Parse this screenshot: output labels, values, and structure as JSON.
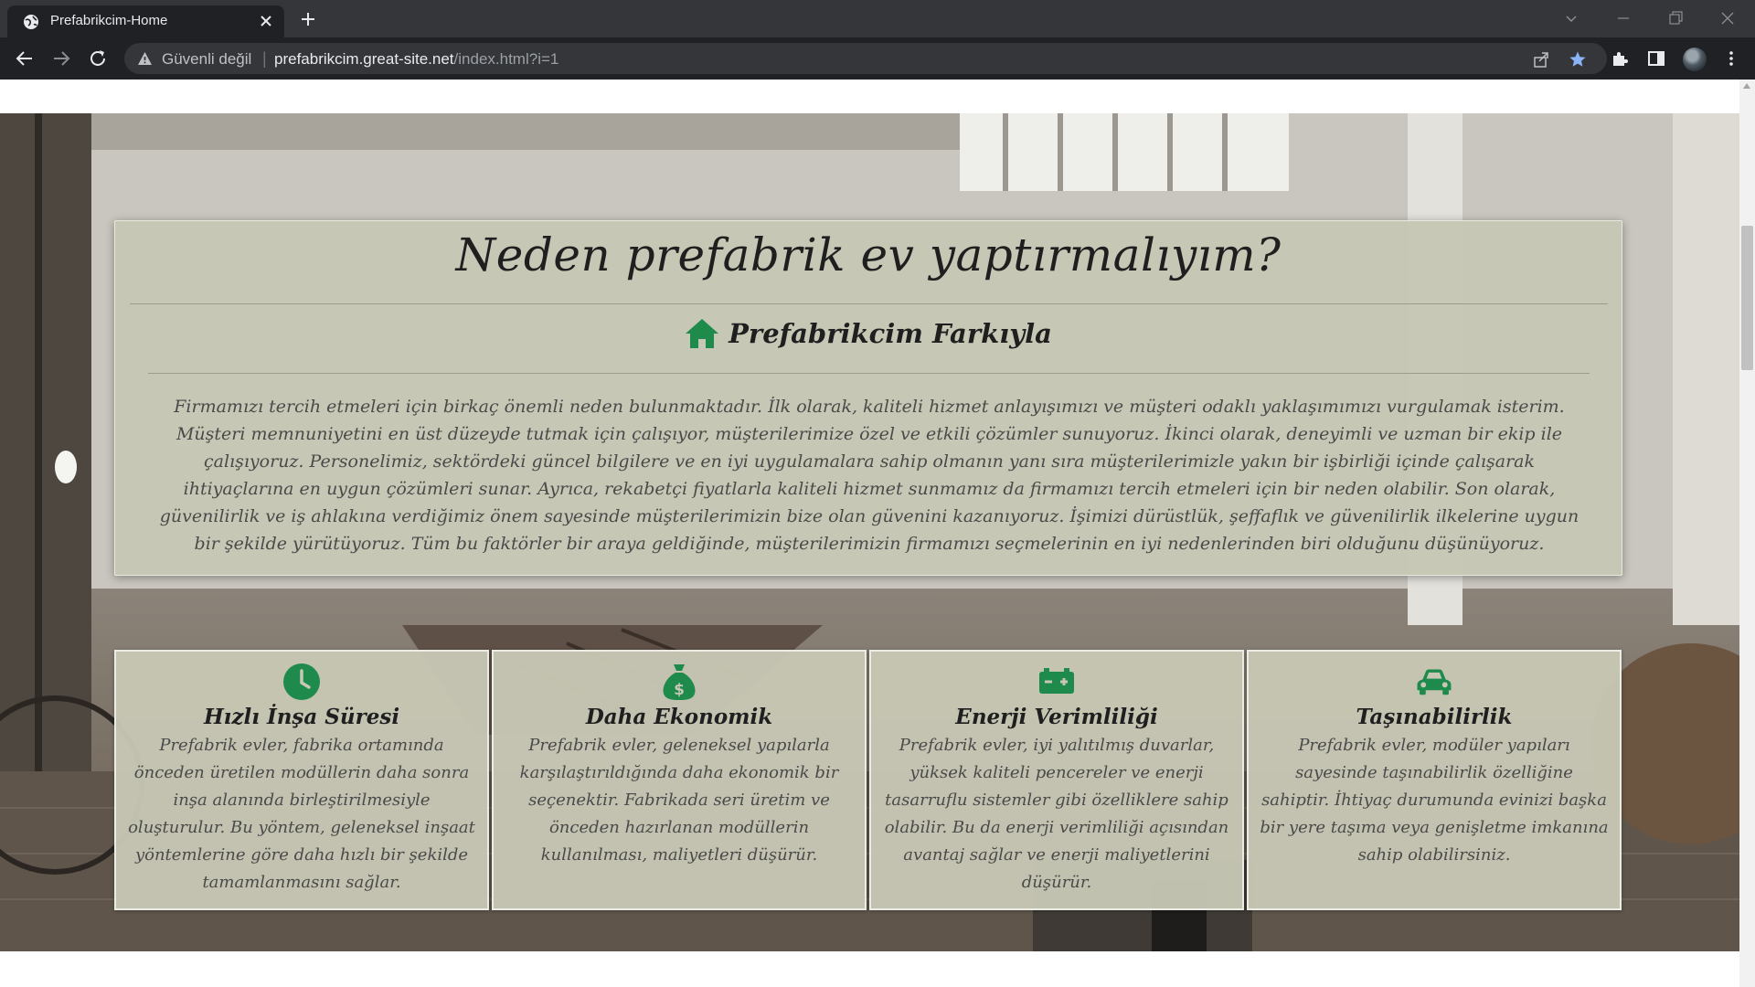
{
  "browser": {
    "tab_title": "Prefabrikcim-Home",
    "security_label": "Güvenli değil",
    "url_separator": "|",
    "url_host": "prefabrikcim.great-site.net",
    "url_path": "/index.html?i=1"
  },
  "page": {
    "title": "Neden prefabrik ev yaptırmalıyım?",
    "subtitle": "Prefabrikcim Farkıyla",
    "body": "Firmamızı tercih etmeleri için birkaç önemli neden bulunmaktadır. İlk olarak, kaliteli hizmet anlayışımızı ve müşteri odaklı yaklaşımımızı vurgulamak isterim. Müşteri memnuniyetini en üst düzeyde tutmak için çalışıyor, müşterilerimize özel ve etkili çözümler sunuyoruz. İkinci olarak, deneyimli ve uzman bir ekip ile çalışıyoruz. Personelimiz, sektördeki güncel bilgilere ve en iyi uygulamalara sahip olmanın yanı sıra müşterilerimizle yakın bir işbirliği içinde çalışarak ihtiyaçlarına en uygun çözümleri sunar. Ayrıca, rekabetçi fiyatlarla kaliteli hizmet sunmamız da firmamızı tercih etmeleri için bir neden olabilir. Son olarak, güvenilirlik ve iş ahlakına verdiğimiz önem sayesinde müşterilerimizin bize olan güvenini kazanıyoruz. İşimizi dürüstlük, şeffaflık ve güvenilirlik ilkelerine uygun bir şekilde yürütüyoruz. Tüm bu faktörler bir araya geldiğinde, müşterilerimizin firmamızı seçmelerinin en iyi nedenlerinden biri olduğunu düşünüyoruz."
  },
  "features": [
    {
      "icon": "clock-icon",
      "title": "Hızlı İnşa Süresi",
      "text": "Prefabrik evler, fabrika ortamında önceden üretilen modüllerin daha sonra inşa alanında birleştirilmesiyle oluşturulur. Bu yöntem, geleneksel inşaat yöntemlerine göre daha hızlı bir şekilde tamamlanmasını sağlar."
    },
    {
      "icon": "money-bag-icon",
      "title": "Daha Ekonomik",
      "text": "Prefabrik evler, geleneksel yapılarla karşılaştırıldığında daha ekonomik bir seçenektir. Fabrikada seri üretim ve önceden hazırlanan modüllerin kullanılması, maliyetleri düşürür."
    },
    {
      "icon": "battery-icon",
      "title": "Enerji Verimliliği",
      "text": "Prefabrik evler, iyi yalıtılmış duvarlar, yüksek kaliteli pencereler ve enerji tasarruflu sistemler gibi özelliklere sahip olabilir. Bu da enerji verimliliği açısından avantaj sağlar ve enerji maliyetlerini düşürür."
    },
    {
      "icon": "car-icon",
      "title": "Taşınabilirlik",
      "text": "Prefabrik evler, modüler yapıları sayesinde taşınabilirlik özelliğine sahiptir. İhtiyaç durumunda evinizi başka bir yere taşıma veya genişletme imkanına sahip olabilirsiniz."
    }
  ],
  "colors": {
    "accent_green": "#1e8a4c",
    "card_bg": "#c7c7b4",
    "chrome_dark": "#202124"
  }
}
